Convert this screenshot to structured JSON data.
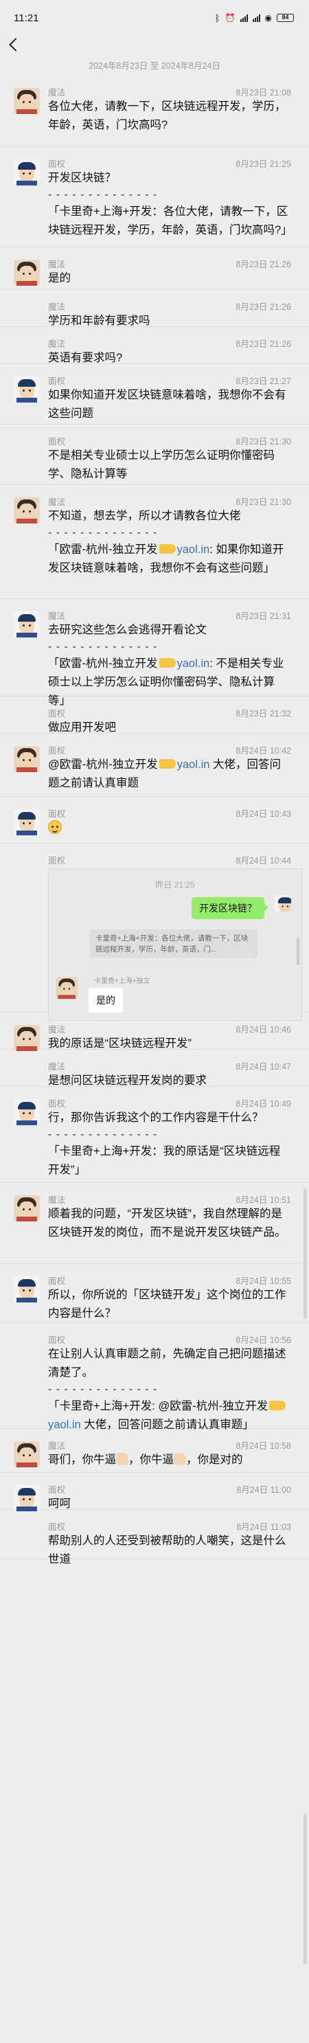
{
  "status_bar": {
    "time": "11:21",
    "icons": "ᛒ ⏰ ▮▮ ▮▮ ◉",
    "battery": "84"
  },
  "date_range": "2024年8月23日 至 2024年8月24日",
  "messages": [
    {
      "sender": "魔法",
      "time": "8月23日 21:08",
      "avatar": "a",
      "lines": [
        "各位大佬，请教一下，区块链远程开发，学历，年龄，英语，门坎高吗?"
      ]
    },
    {
      "sender": "面权",
      "time": "8月23日 21:25",
      "avatar": "b",
      "lines": [
        "开发区块链？"
      ],
      "sep": "- - - - - - - - - - - - - -",
      "quote": "「卡里奇+上海+开发：各位大佬，请教一下，区块链远程开发，学历，年龄，英语，门坎高吗?」"
    },
    {
      "sender": "魔法",
      "time": "8月23日 21:26",
      "avatar": "a",
      "lines": [
        "是的"
      ]
    },
    {
      "sender": "魔法",
      "time": "8月23日 21:26",
      "avatar": "",
      "lines": [
        "学历和年龄有要求吗"
      ]
    },
    {
      "sender": "魔法",
      "time": "8月23日 21:26",
      "avatar": "",
      "lines": [
        "英语有要求吗?"
      ]
    },
    {
      "sender": "面权",
      "time": "8月23日 21:27",
      "avatar": "b",
      "lines": [
        "如果你知道开发区块链意味着啥，我想你不会有这些问题"
      ]
    },
    {
      "sender": "面权",
      "time": "8月23日 21:30",
      "avatar": "",
      "lines": [
        "不是相关专业硕士以上学历怎么证明你懂密码学、隐私计算等"
      ]
    },
    {
      "sender": "魔法",
      "time": "8月23日 21:30",
      "avatar": "a",
      "lines": [
        "不知道，想去学，所以才请教各位大佬"
      ],
      "sep": "- - - - - - - - - - - - - -",
      "quote_pre": "「欧雷-杭州-独立开发",
      "quote_link": "yaol.in",
      "quote_post": ": 如果你知道开发区块链意味着啥，我想你不会有这些问题」"
    },
    {
      "sender": "魔法",
      "time": "8月23日 21:31",
      "avatar": "b",
      "lines": [
        "去研究这些怎么会逃得开看论文"
      ],
      "sep": "- - - - - - - - - - - - - -",
      "quote_pre": "「欧雷-杭州-独立开发",
      "quote_link": "yaol.in",
      "quote_post": ": 不是相关专业硕士以上学历怎么证明你懂密码学、隐私计算等」"
    },
    {
      "sender": "面权",
      "time": "8月23日 21:32",
      "avatar": "",
      "lines": [
        "做应用开发吧"
      ]
    },
    {
      "sender": "面权",
      "time": "8月24日 10:42",
      "avatar": "a",
      "mention_pre": "@欧雷-杭州-独立开发",
      "mention_link": "yaol.in",
      "mention_post": " 大佬，回答问题之前请认真审题"
    },
    {
      "sender": "面权",
      "time": "8月24日 10:43",
      "avatar": "b",
      "emoji": true
    },
    {
      "sender": "面权",
      "time": "8月24日 10:44",
      "avatar": "",
      "embed": {
        "time": "昨日 21:25",
        "bubble_right": "开发区块链？",
        "quote": "卡里奇+上海+开发：各位大佬，请教一下，区块链远程开发，学历，年龄，英语，门...",
        "sender": "卡里奇+上海+独立",
        "bubble_left": "是的"
      }
    },
    {
      "sender": "魔法",
      "time": "8月24日 10:46",
      "avatar": "a",
      "lines": [
        "我的原话是“区块链远程开发”"
      ]
    },
    {
      "sender": "魔法",
      "time": "8月24日 10:47",
      "avatar": "",
      "lines": [
        "是想问区块链远程开发岗的要求"
      ]
    },
    {
      "sender": "面权",
      "time": "8月24日 10:49",
      "avatar": "b",
      "lines": [
        "行，那你告诉我这个的工作内容是干什么？"
      ],
      "sep": "- - - - - - - - - - - - - -",
      "quote": "「卡里奇+上海+开发：我的原话是“区块链远程开发”」"
    },
    {
      "sender": "魔法",
      "time": "8月24日 10:51",
      "avatar": "a",
      "lines": [
        "顺着我的问题，“开发区块链”，我自然理解的是区块链开发的岗位，而不是说开发区块链产品。"
      ]
    },
    {
      "sender": "面权",
      "time": "8月24日 10:55",
      "avatar": "b",
      "lines": [
        "所以，你所说的「区块链开发」这个岗位的工作内容是什么？"
      ]
    },
    {
      "sender": "面权",
      "time": "8月24日 10:56",
      "avatar": "",
      "lines": [
        "在让别人认真审题之前，先确定自己把问题描述清楚了。"
      ],
      "sep": "- - - - - - - - - - - - - -",
      "quote_pre": "「卡里奇+上海+开发: @欧雷-杭州-独立开发",
      "quote_link": "yaol.in",
      "quote_post": " 大佬，回答问题之前请认真审题」"
    },
    {
      "sender": "魔法",
      "time": "8月24日 10:58",
      "avatar": "a",
      "praise": true
    },
    {
      "sender": "面权",
      "time": "8月24日 11:00",
      "avatar": "b",
      "lines": [
        "呵呵"
      ]
    },
    {
      "sender": "面权",
      "time": "8月24日 11:03",
      "avatar": "",
      "lines": [
        "帮助别人的人还受到被帮助的人嘲笑，这是什么世道"
      ]
    }
  ],
  "praise": {
    "p1": "哥们，你牛逼",
    "p2": "，你牛逼",
    "p3": "，你是对的"
  }
}
